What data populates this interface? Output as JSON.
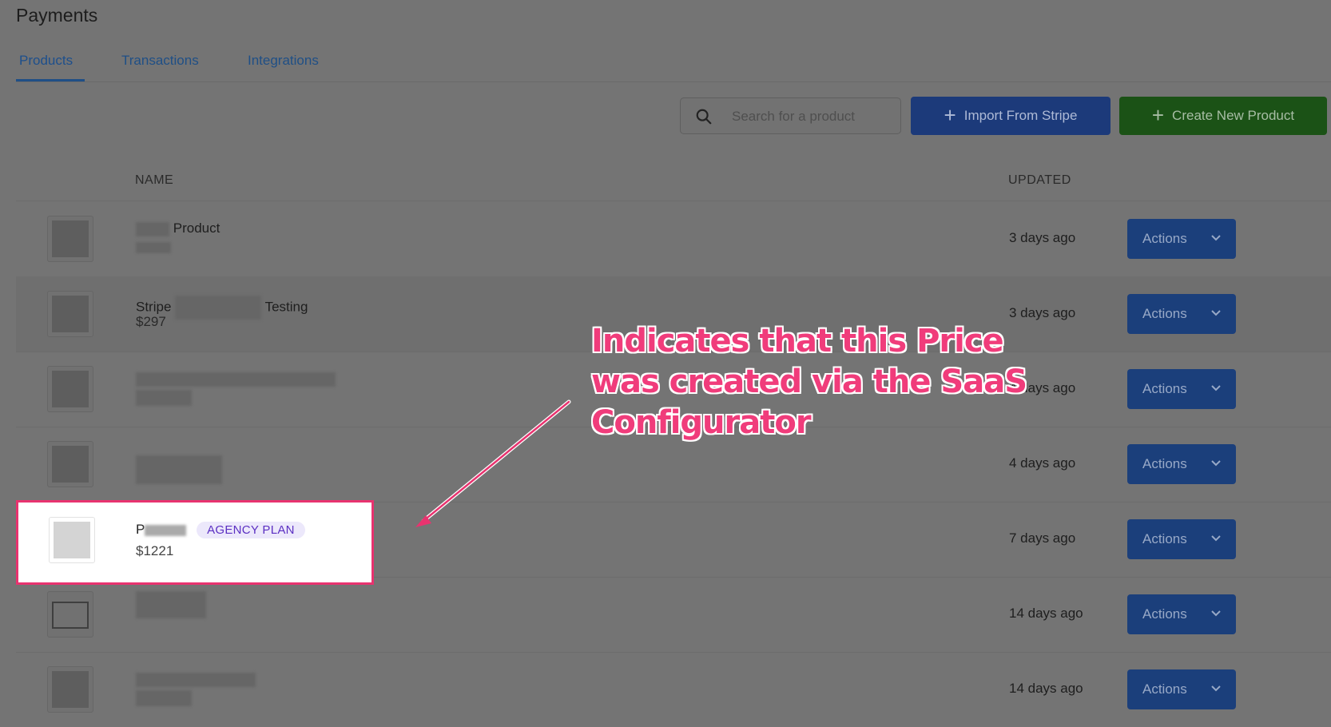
{
  "page": {
    "title": "Payments"
  },
  "tabs": [
    {
      "label": "Products",
      "active": true
    },
    {
      "label": "Transactions",
      "active": false
    },
    {
      "label": "Integrations",
      "active": false
    }
  ],
  "toolbar": {
    "search_placeholder": "Search for a product",
    "import_label": "Import From Stripe",
    "create_label": "Create New Product"
  },
  "table": {
    "headers": {
      "name": "NAME",
      "updated": "UPDATED"
    },
    "rows": [
      {
        "name": "Product",
        "price": "",
        "updated": "3 days ago",
        "action": "Actions"
      },
      {
        "name_prefix": "Stripe",
        "name_suffix": "Testing",
        "price": "$297",
        "updated": "3 days ago",
        "action": "Actions"
      },
      {
        "name": "",
        "price": "",
        "updated": "4 days ago",
        "action": "Actions"
      },
      {
        "name": "",
        "price": "",
        "updated": "4 days ago",
        "action": "Actions"
      },
      {
        "name": "P",
        "badge": "AGENCY PLAN",
        "price": "$1221",
        "updated": "7 days ago",
        "action": "Actions"
      },
      {
        "name": "",
        "price": "",
        "updated": "14 days ago",
        "action": "Actions"
      },
      {
        "name": "",
        "price": "",
        "updated": "14 days ago",
        "action": "Actions"
      }
    ]
  },
  "annotation": {
    "text": "Indicates that this Price was created via the SaaS Configurator",
    "color": "#f03c7b"
  },
  "colors": {
    "primary_blue": "#1c3a7a",
    "create_green": "#1b5216",
    "badge_purple": "#5b2fc2",
    "highlight": "#e8336f"
  }
}
